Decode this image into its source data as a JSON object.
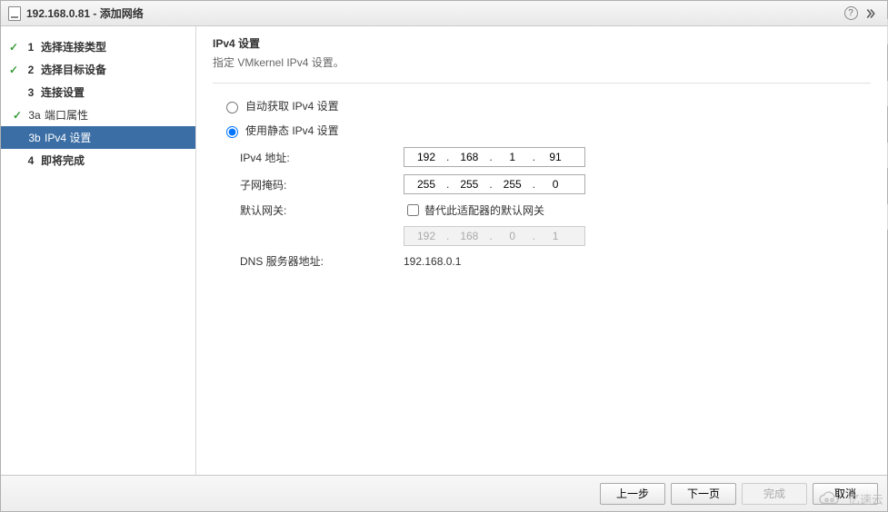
{
  "titlebar": {
    "title": "192.168.0.81 - 添加网络",
    "help_tooltip": "?",
    "expand_tooltip": "»"
  },
  "nav": {
    "items": [
      {
        "num": "1",
        "label": "选择连接类型",
        "done": true,
        "sub": false
      },
      {
        "num": "2",
        "label": "选择目标设备",
        "done": true,
        "sub": false
      },
      {
        "num": "3",
        "label": "连接设置",
        "done": false,
        "sub": false
      },
      {
        "num": "3a",
        "label": "端口属性",
        "done": true,
        "sub": true
      },
      {
        "num": "3b",
        "label": "IPv4 设置",
        "done": false,
        "sub": true,
        "active": true
      },
      {
        "num": "4",
        "label": "即将完成",
        "done": false,
        "sub": false
      }
    ]
  },
  "content": {
    "heading": "IPv4 设置",
    "subheading": "指定 VMkernel IPv4 设置。",
    "radio_auto": "自动获取 IPv4 设置",
    "radio_static": "使用静态 IPv4 设置",
    "selected_radio": "static",
    "fields": {
      "ipv4_label": "IPv4 地址:",
      "ipv4_value": [
        "192",
        "168",
        "1",
        "91"
      ],
      "mask_label": "子网掩码:",
      "mask_value": [
        "255",
        "255",
        "255",
        "0"
      ],
      "gateway_label": "默认网关:",
      "override_label": "替代此适配器的默认网关",
      "override_checked": false,
      "gateway_value": [
        "192",
        "168",
        "0",
        "1"
      ],
      "dns_label": "DNS 服务器地址:",
      "dns_value": "192.168.0.1"
    }
  },
  "footer": {
    "back": "上一步",
    "next": "下一页",
    "finish": "完成",
    "cancel": "取消"
  },
  "watermark": "亿速云"
}
